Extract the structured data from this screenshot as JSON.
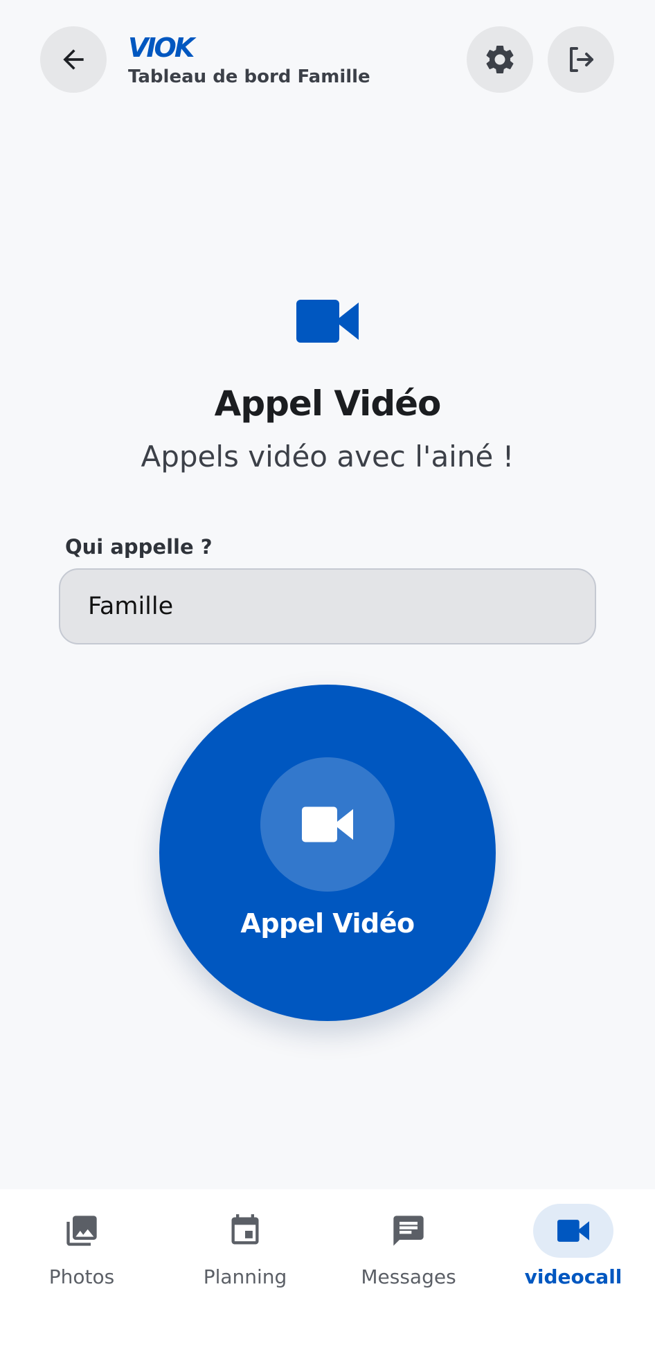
{
  "header": {
    "brand": "VIOK",
    "subtitle": "Tableau de bord Famille",
    "icons": {
      "back": "arrow-left-icon",
      "settings": "gear-icon",
      "logout": "logout-icon"
    }
  },
  "hero": {
    "icon": "video-camera-icon",
    "title": "Appel Vidéo",
    "subtitle": "Appels vidéo avec l'ainé !"
  },
  "form": {
    "caller_label": "Qui appelle ?",
    "caller_value": "Famille"
  },
  "call_button": {
    "label": "Appel Vidéo",
    "icon": "video-camera-icon"
  },
  "nav": {
    "items": [
      {
        "label": "Photos",
        "icon": "photo-library-icon",
        "active": false
      },
      {
        "label": "Planning",
        "icon": "calendar-icon",
        "active": false
      },
      {
        "label": "Messages",
        "icon": "message-icon",
        "active": false
      },
      {
        "label": "videocall",
        "icon": "video-camera-icon",
        "active": true
      }
    ]
  },
  "colors": {
    "accent": "#0057c0",
    "background": "#f7f8fa",
    "nav_active_bg": "#e1ebf7",
    "button_gray": "#e6e7e9"
  }
}
